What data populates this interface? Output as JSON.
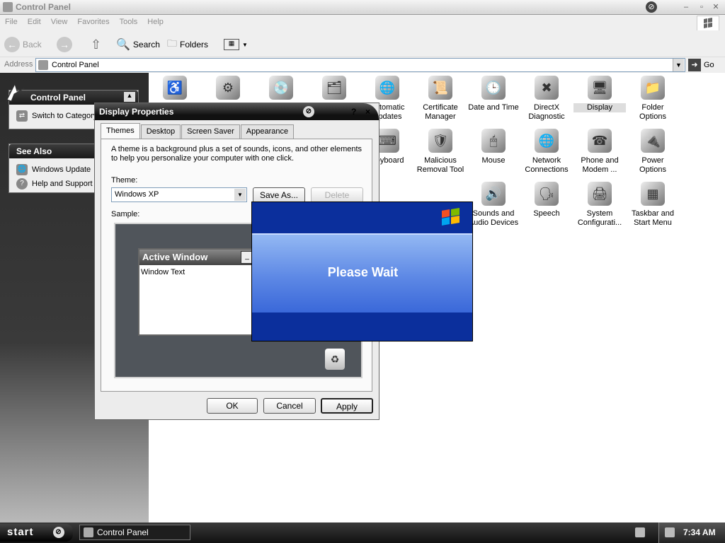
{
  "window": {
    "title": "Control Panel"
  },
  "menu": [
    "File",
    "Edit",
    "View",
    "Favorites",
    "Tools",
    "Help"
  ],
  "toolbar": {
    "back": "Back",
    "search": "Search",
    "folders": "Folders"
  },
  "address": {
    "label": "Address",
    "value": "Control Panel",
    "go": "Go"
  },
  "left": {
    "control_panel": {
      "title": "Control Panel",
      "item": "Switch to Category View"
    },
    "see_also": {
      "title": "See Also",
      "items": [
        "Windows Update",
        "Help and Support"
      ]
    }
  },
  "icons": [
    {
      "label": "",
      "glyph": "♿"
    },
    {
      "label": "",
      "glyph": "⚙"
    },
    {
      "label": "",
      "glyph": "💿"
    },
    {
      "label": "",
      "glyph": "🗂"
    },
    {
      "label": "Automatic Updates",
      "glyph": "🌐"
    },
    {
      "label": "Certificate Manager",
      "glyph": "📜"
    },
    {
      "label": "Date and Time",
      "glyph": "🕒"
    },
    {
      "label": "DirectX Diagnostic",
      "glyph": "✖"
    },
    {
      "label": "Display",
      "glyph": "🖥"
    },
    {
      "label": "Folder Options",
      "glyph": "📁"
    },
    {
      "label": "Keyboard",
      "glyph": "⌨"
    },
    {
      "label": "Malicious Removal Tool",
      "glyph": "🛡"
    },
    {
      "label": "Mouse",
      "glyph": "🖱"
    },
    {
      "label": "Network Connections",
      "glyph": "🌐"
    },
    {
      "label": "Phone and Modem ...",
      "glyph": "☎"
    },
    {
      "label": "Power Options",
      "glyph": "🔌"
    },
    {
      "label": "Sounds and Audio Devices",
      "glyph": "🔊"
    },
    {
      "label": "Speech",
      "glyph": "🗣"
    },
    {
      "label": "System Configurati...",
      "glyph": "🖨"
    },
    {
      "label": "Taskbar and Start Menu",
      "glyph": "▦"
    }
  ],
  "display_properties": {
    "title": "Display Properties",
    "help": "?",
    "close": "×",
    "tabs": [
      "Themes",
      "Desktop",
      "Screen Saver",
      "Appearance"
    ],
    "description": "A theme is a background plus a set of sounds, icons, and other elements to help you personalize your computer with one click.",
    "theme_label": "Theme:",
    "theme_value": "Windows XP",
    "save_as": "Save As...",
    "delete": "Delete",
    "sample_label": "Sample:",
    "active_window": "Active Window",
    "window_text": "Window Text",
    "ok": "OK",
    "cancel": "Cancel",
    "apply": "Apply"
  },
  "please_wait": {
    "text": "Please Wait"
  },
  "taskbar": {
    "start": "start",
    "task": "Control Panel",
    "time": "7:34 AM"
  }
}
